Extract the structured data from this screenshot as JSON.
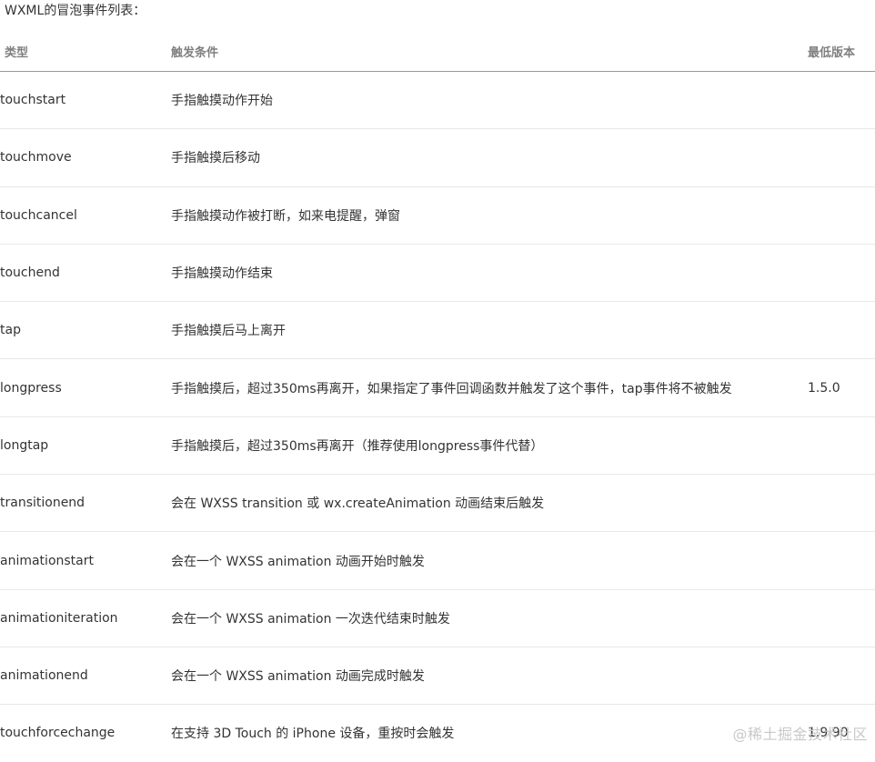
{
  "title": "WXML的冒泡事件列表：",
  "columns": {
    "type": "类型",
    "condition": "触发条件",
    "version": "最低版本"
  },
  "rows": [
    {
      "type": "touchstart",
      "condition": "手指触摸动作开始",
      "version": ""
    },
    {
      "type": "touchmove",
      "condition": "手指触摸后移动",
      "version": ""
    },
    {
      "type": "touchcancel",
      "condition": "手指触摸动作被打断，如来电提醒，弹窗",
      "version": ""
    },
    {
      "type": "touchend",
      "condition": "手指触摸动作结束",
      "version": ""
    },
    {
      "type": "tap",
      "condition": "手指触摸后马上离开",
      "version": ""
    },
    {
      "type": "longpress",
      "condition": "手指触摸后，超过350ms再离开，如果指定了事件回调函数并触发了这个事件，tap事件将不被触发",
      "version": "1.5.0"
    },
    {
      "type": "longtap",
      "condition": "手指触摸后，超过350ms再离开（推荐使用longpress事件代替）",
      "version": ""
    },
    {
      "type": "transitionend",
      "condition": "会在 WXSS transition 或 wx.createAnimation 动画结束后触发",
      "version": ""
    },
    {
      "type": "animationstart",
      "condition": "会在一个 WXSS animation 动画开始时触发",
      "version": ""
    },
    {
      "type": "animationiteration",
      "condition": "会在一个 WXSS animation 一次迭代结束时触发",
      "version": ""
    },
    {
      "type": "animationend",
      "condition": "会在一个 WXSS animation 动画完成时触发",
      "version": ""
    },
    {
      "type": "touchforcechange",
      "condition": "在支持 3D Touch 的 iPhone 设备，重按时会触发",
      "version": "1.9.90"
    }
  ],
  "watermark": "@稀土掘金技术社区"
}
